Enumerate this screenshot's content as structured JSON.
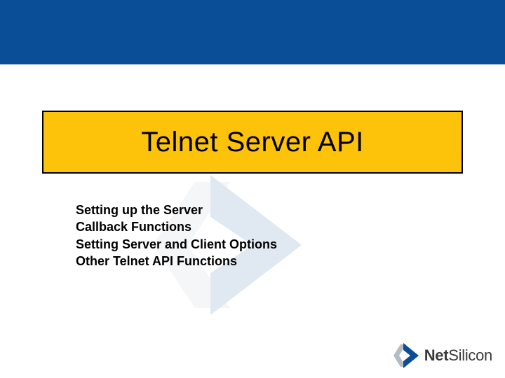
{
  "colors": {
    "header": "#0a4e98",
    "title_bg": "#fdc20a",
    "title_border": "#000000",
    "brand_blue": "#0a4e98",
    "brand_gray": "#b5bbc2"
  },
  "title": "Telnet Server API",
  "bullets": [
    "Setting up the Server",
    "Callback Functions",
    "Setting Server and Client Options",
    "Other Telnet API Functions"
  ],
  "brand": {
    "name_strong": "Net",
    "name_light": "Silicon",
    "icon": "netsilicon-arrow-icon"
  }
}
